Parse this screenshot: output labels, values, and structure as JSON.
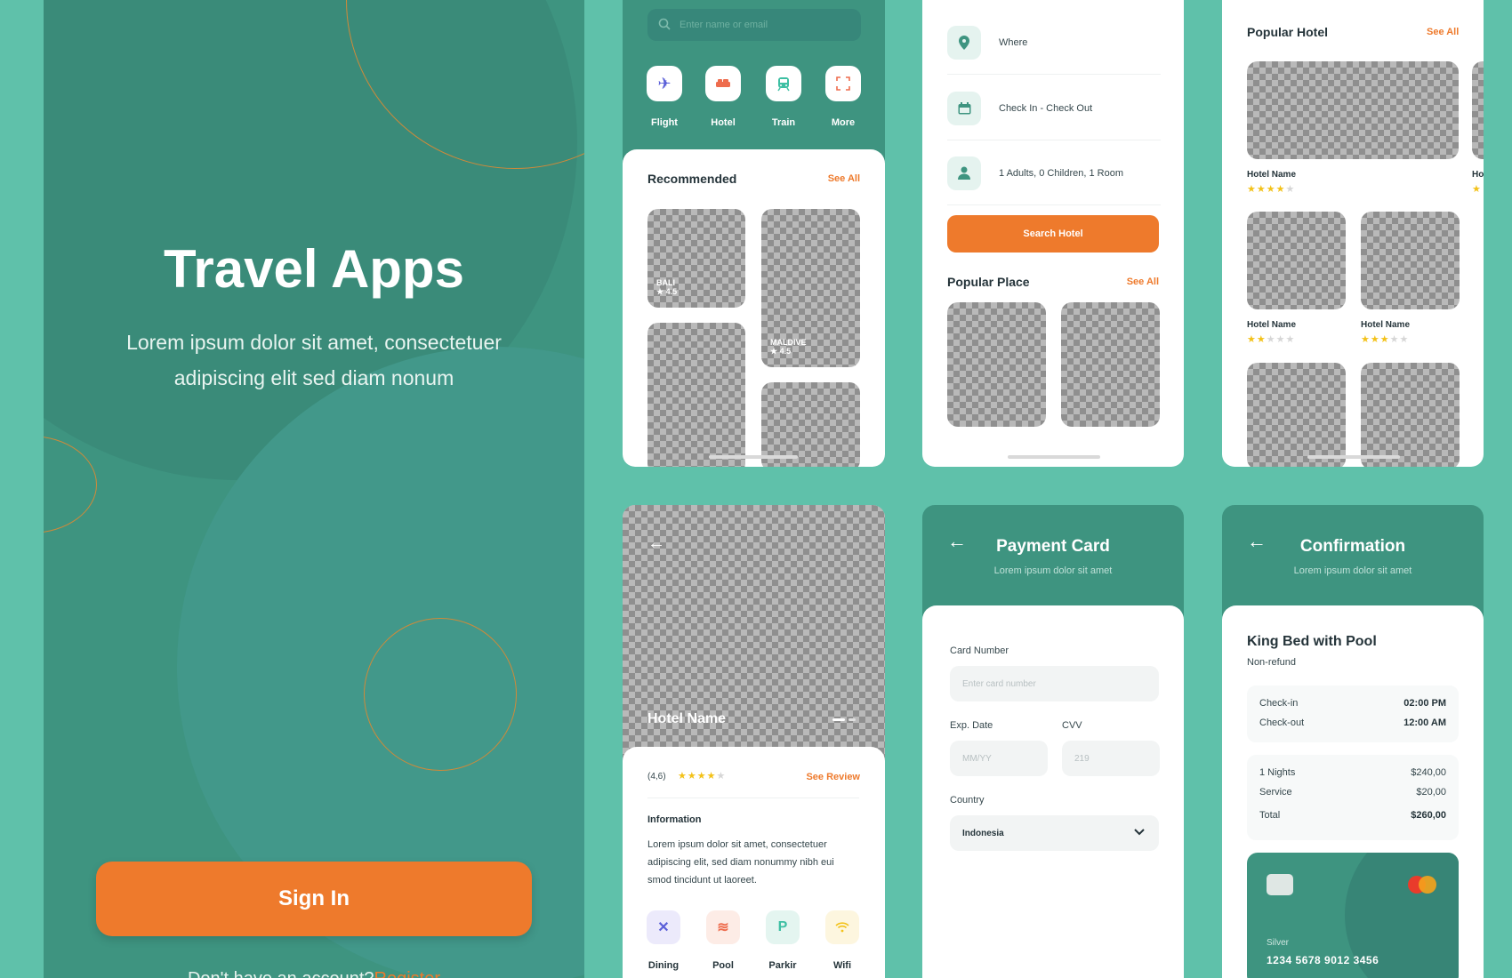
{
  "intro": {
    "title": "Travel Apps",
    "subtitle_line1": "Lorem ipsum dolor sit amet, consectetuer",
    "subtitle_line2": "adipiscing elit sed diam nonum",
    "signin_label": "Sign In",
    "account_prompt": "Don't have an account?",
    "register_label": "Register"
  },
  "home": {
    "search_placeholder": "Enter name or email",
    "categories": [
      {
        "label": "Flight",
        "icon": "plane-icon",
        "color": "#5a5fd8"
      },
      {
        "label": "Hotel",
        "icon": "bed-icon",
        "color": "#ee6c4d"
      },
      {
        "label": "Train",
        "icon": "train-icon",
        "color": "#3ebfa3"
      },
      {
        "label": "More",
        "icon": "more-icon",
        "color": "#ee6c4d"
      }
    ],
    "recommended_title": "Recommended",
    "see_all": "See All",
    "tiles": [
      {
        "name": "BALI",
        "rating": "4.5"
      },
      {
        "name": "MALDIVE",
        "rating": "4.5"
      }
    ]
  },
  "search_form": {
    "where": "Where",
    "dates": "Check In - Check Out",
    "guests": "1 Adults, 0 Children, 1 Room",
    "search_button": "Search Hotel",
    "popular_place_title": "Popular Place",
    "see_all": "See All"
  },
  "popular_hotel": {
    "title": "Popular Hotel",
    "see_all": "See All",
    "hotel_name": "Hotel Name",
    "partial_name": "Ho",
    "ratings": [
      4,
      2,
      3
    ]
  },
  "hotel_detail": {
    "hotel_name": "Hotel Name",
    "rating_text": "(4,6)",
    "rating": 4,
    "see_review": "See Review",
    "info_title": "Information",
    "info_text": "Lorem ipsum dolor sit amet, consectetuer adipiscing elit, sed diam nonummy nibh eui smod tincidunt ut laoreet.",
    "amenities": [
      {
        "label": "Dining",
        "icon": "dining-icon",
        "bg": "#eceafb",
        "color": "#5a5fd8"
      },
      {
        "label": "Pool",
        "icon": "pool-icon",
        "bg": "#fdece6",
        "color": "#ee6c4d"
      },
      {
        "label": "Parkir",
        "icon": "parking-icon",
        "bg": "#e4f5f0",
        "color": "#3ebfa3"
      },
      {
        "label": "Wifi",
        "icon": "wifi-icon",
        "bg": "#fdf6df",
        "color": "#f3c21a"
      }
    ]
  },
  "payment": {
    "title": "Payment Card",
    "subtitle": "Lorem ipsum dolor sit amet",
    "card_number_label": "Card Number",
    "card_number_placeholder": "Enter card number",
    "exp_label": "Exp. Date",
    "exp_placeholder": "MM/YY",
    "cvv_label": "CVV",
    "cvv_placeholder": "219",
    "country_label": "Country",
    "country_value": "Indonesia"
  },
  "confirmation": {
    "title": "Confirmation",
    "subtitle": "Lorem ipsum dolor sit amet",
    "room": "King Bed with Pool",
    "refund": "Non-refund",
    "checkin_label": "Check-in",
    "checkin_time": "02:00 PM",
    "checkout_label": "Check-out",
    "checkout_time": "12:00 AM",
    "nights_label": "1 Nights",
    "nights_price": "$240,00",
    "service_label": "Service",
    "service_price": "$20,00",
    "total_label": "Total",
    "total_price": "$260,00",
    "card_tier": "Silver",
    "card_number": "1234 5678 9012 3456"
  },
  "colors": {
    "teal": "#3e9480",
    "background": "#5fc1aa",
    "accent": "#ee7a2c"
  }
}
